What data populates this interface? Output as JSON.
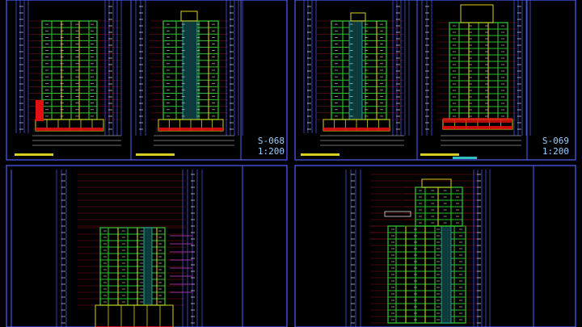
{
  "sheets": [
    {
      "code": "S-068",
      "scale": "1:200"
    },
    {
      "code": "S-069",
      "scale": "1:200"
    }
  ],
  "colors": {
    "background": "#000000",
    "frame": "#4f5fff",
    "grid_red": "#8a1010",
    "floor_green": "#30c030",
    "column_yellow": "#d8d020",
    "column_cyan": "#30c0c0",
    "text_white": "#e0e0e0",
    "accent_red": "#e01010",
    "magenta": "#d040d0",
    "label_blue": "#9ad0ff"
  }
}
